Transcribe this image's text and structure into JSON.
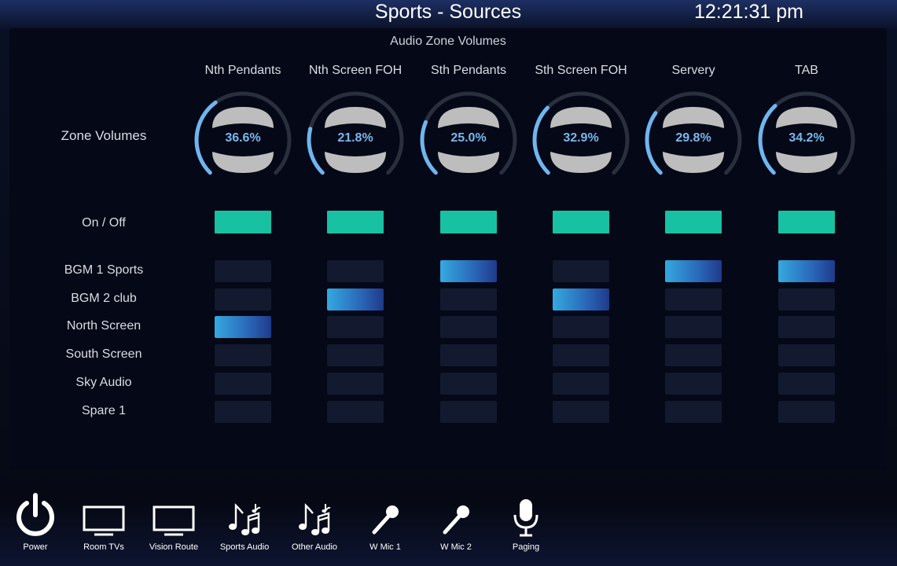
{
  "header": {
    "title": "Sports - Sources",
    "time": "12:21:31 pm"
  },
  "panel": {
    "title": "Audio Zone Volumes",
    "zone_volumes_label": "Zone Volumes",
    "on_off_label": "On / Off",
    "zones": [
      {
        "name": "Nth Pendants",
        "volume": "36.6%",
        "volume_value": 36.6,
        "on": true
      },
      {
        "name": "Nth Screen FOH",
        "volume": "21.8%",
        "volume_value": 21.8,
        "on": true
      },
      {
        "name": "Sth Pendants",
        "volume": "25.0%",
        "volume_value": 25.0,
        "on": true
      },
      {
        "name": "Sth Screen FOH",
        "volume": "32.9%",
        "volume_value": 32.9,
        "on": true
      },
      {
        "name": "Servery",
        "volume": "29.8%",
        "volume_value": 29.8,
        "on": true
      },
      {
        "name": "TAB",
        "volume": "34.2%",
        "volume_value": 34.2,
        "on": true
      }
    ],
    "sources": [
      {
        "name": "BGM 1 Sports",
        "active_zones": [
          2,
          4,
          5
        ]
      },
      {
        "name": "BGM 2 club",
        "active_zones": [
          1,
          3
        ]
      },
      {
        "name": "North Screen",
        "active_zones": [
          0
        ]
      },
      {
        "name": "South Screen",
        "active_zones": []
      },
      {
        "name": "Sky Audio",
        "active_zones": []
      },
      {
        "name": "Spare 1",
        "active_zones": []
      }
    ]
  },
  "footer": {
    "items": [
      {
        "label": "Power",
        "icon": "power-icon"
      },
      {
        "label": "Room TVs",
        "icon": "tv-icon"
      },
      {
        "label": "Vision Route",
        "icon": "tv-icon"
      },
      {
        "label": "Sports Audio",
        "icon": "music-notes-icon"
      },
      {
        "label": "Other Audio",
        "icon": "music-notes-icon"
      },
      {
        "label": "W Mic 1",
        "icon": "handheld-mic-icon"
      },
      {
        "label": "W Mic 2",
        "icon": "handheld-mic-icon"
      },
      {
        "label": "Paging",
        "icon": "paging-mic-icon"
      }
    ]
  },
  "colors": {
    "accent": "#6fb6f0",
    "on_button": "#17c1a2",
    "inactive_button": "#131a2f",
    "active_gradient_start": "#34a9e0",
    "active_gradient_end": "#1f3a8a"
  }
}
